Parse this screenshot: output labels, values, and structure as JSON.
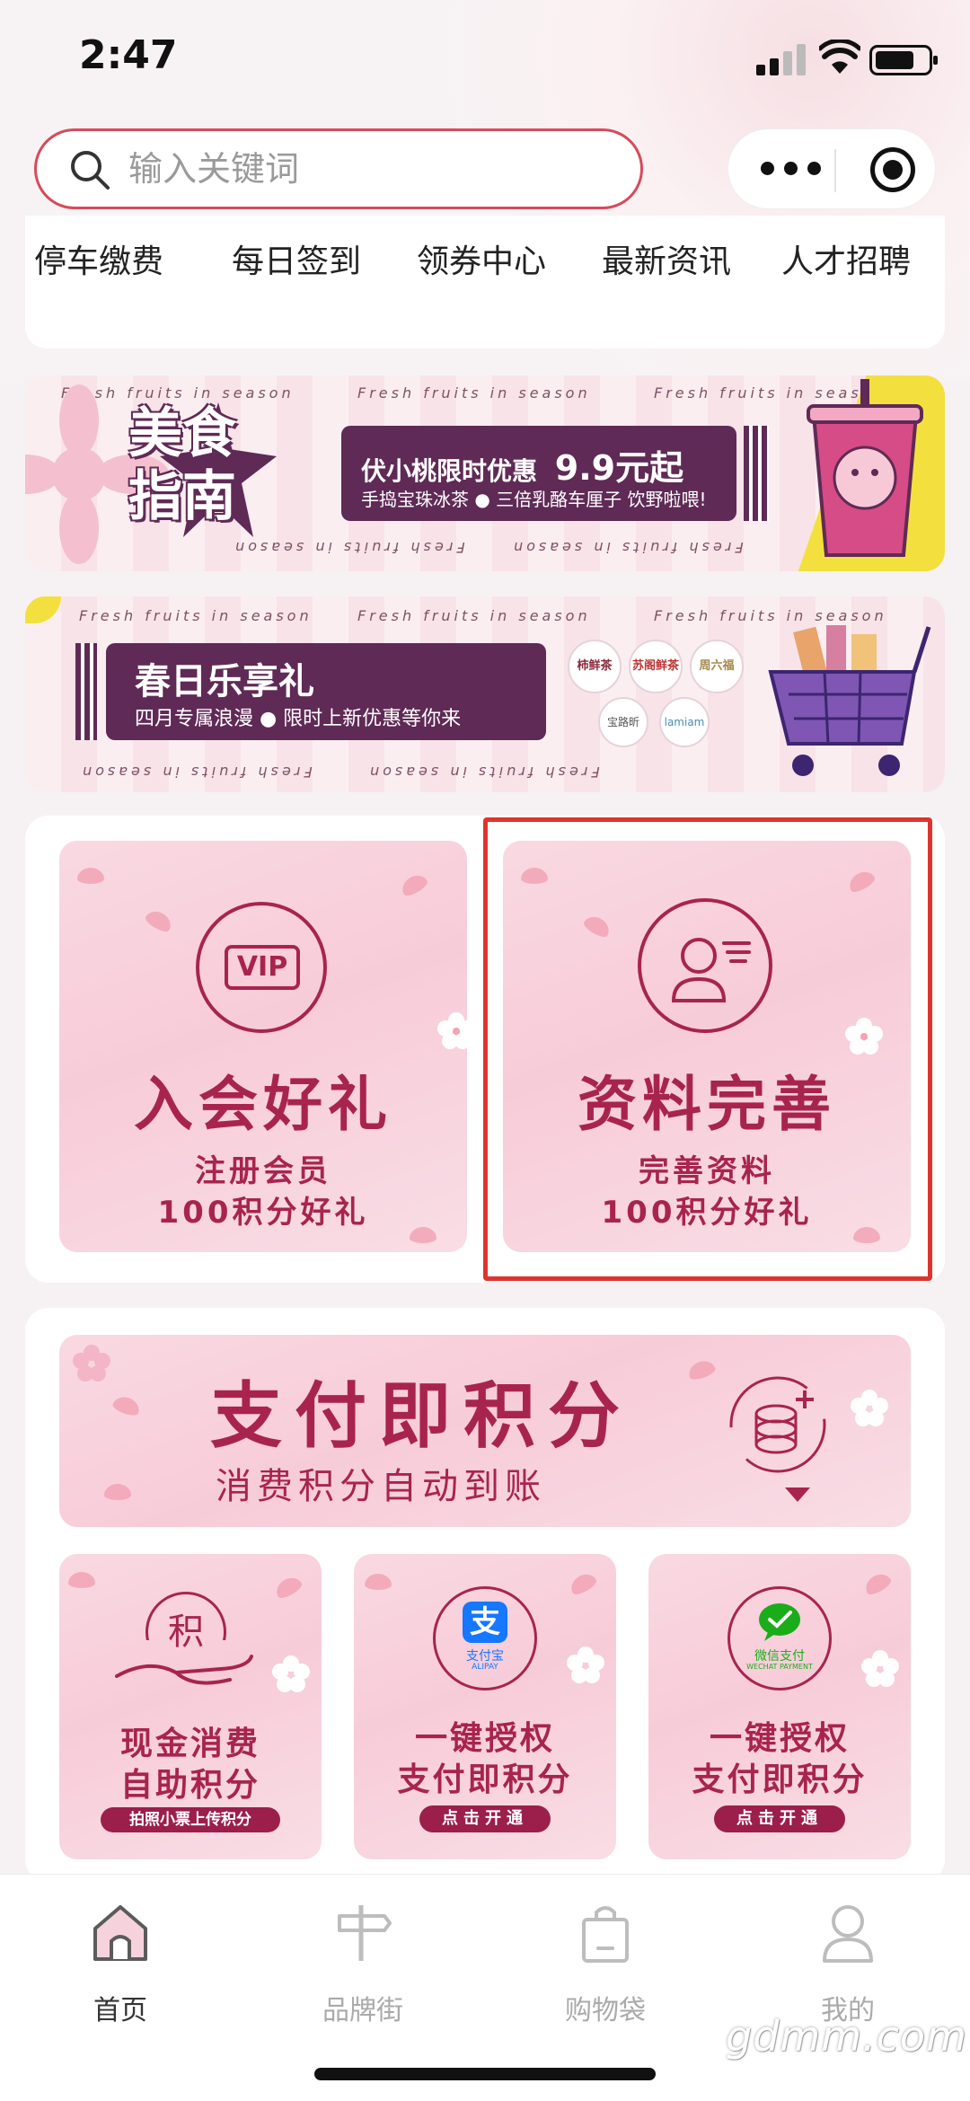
{
  "status_bar": {
    "time": "2:47"
  },
  "search": {
    "placeholder": "输入关键词"
  },
  "quick_nav": [
    "停车缴费",
    "每日签到",
    "领券中心",
    "最新资讯",
    "人才招聘"
  ],
  "banner_food": {
    "stamp_line1": "美食",
    "stamp_line2": "指南",
    "promo_title": "伏小桃限时优惠",
    "promo_price": "9.9元起",
    "promo_sub": "手捣宝珠冰茶 ● 三倍乳酪车厘子 饮野啦喂!",
    "tagline": "Fresh fruits in season"
  },
  "banner_spring": {
    "title": "春日乐享礼",
    "sub": "四月专属浪漫 ● 限时上新优惠等你来",
    "tagline": "Fresh fruits in season",
    "brand_logos": [
      "柿鲜茶",
      "苏阁鲜茶",
      "周六福",
      "宝路昕",
      "lamiam"
    ]
  },
  "member_cards": [
    {
      "icon_text": "VIP",
      "title": "入会好礼",
      "line1": "注册会员",
      "line2": "100积分好礼"
    },
    {
      "icon_text": "",
      "title": "资料完善",
      "line1": "完善资料",
      "line2": "100积分好礼"
    }
  ],
  "pay_banner": {
    "title": "支付即积分",
    "sub": "消费积分自动到账"
  },
  "pay_cards": [
    {
      "icon_text": "积",
      "title1": "现金消费",
      "title2": "自助积分",
      "button": "拍照小票上传积分"
    },
    {
      "icon_text": "支",
      "icon_caption": "支付宝",
      "icon_caption2": "ALIPAY",
      "title1": "一键授权",
      "title2": "支付即积分",
      "button": "点击开通"
    },
    {
      "icon_text": "",
      "icon_caption": "微信支付",
      "icon_caption2": "WECHAT PAYMENT",
      "title1": "一键授权",
      "title2": "支付即积分",
      "button": "点击开通"
    }
  ],
  "tabs": [
    {
      "label": "首页",
      "active": true
    },
    {
      "label": "品牌街",
      "active": false
    },
    {
      "label": "购物袋",
      "active": false
    },
    {
      "label": "我的",
      "active": false
    }
  ],
  "watermark": "gdmm.com",
  "colors": {
    "accent": "#a8244f",
    "purple": "#5f2a56",
    "highlight": "#e0332e"
  }
}
